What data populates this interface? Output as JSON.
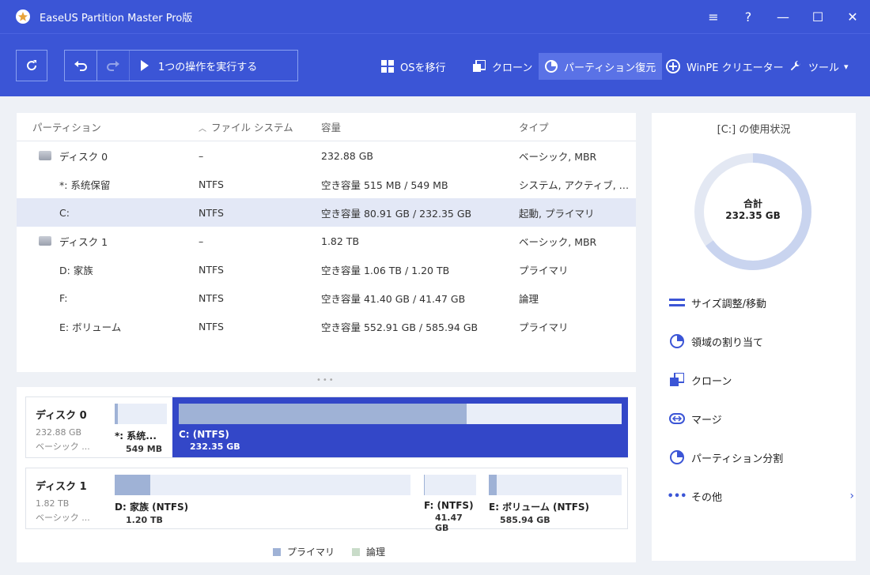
{
  "window": {
    "title": "EaseUS Partition Master Pro版",
    "controls": [
      "≡",
      "?",
      "—",
      "☐",
      "✕"
    ]
  },
  "toolbar": {
    "execute_label": "1つの操作を実行する",
    "nav": [
      {
        "label": "OSを移行",
        "icon": "windows-icon"
      },
      {
        "label": "クローン",
        "icon": "clone-icon"
      },
      {
        "label": "パーティション復元",
        "icon": "pie-icon",
        "active": true
      },
      {
        "label": "WinPE クリエーター",
        "icon": "plus-circle-icon"
      },
      {
        "label": "ツール",
        "icon": "wrench-icon"
      }
    ]
  },
  "table": {
    "headers": [
      "パーティション",
      "ファイル システム",
      "容量",
      "タイプ"
    ],
    "rows": [
      {
        "name": "ディスク 0",
        "fs": "–",
        "cap": "232.88 GB",
        "type": "ベーシック, MBR",
        "disk": true
      },
      {
        "name": "*: 系统保留",
        "fs": "NTFS",
        "cap": "空き容量 515 MB / 549 MB",
        "type": "システム, アクティブ, プライマリ"
      },
      {
        "name": "C:",
        "fs": "NTFS",
        "cap": "空き容量 80.91 GB / 232.35 GB",
        "type": "起動, プライマリ",
        "selected": true
      },
      {
        "name": "ディスク 1",
        "fs": "–",
        "cap": "1.82 TB",
        "type": "ベーシック, MBR",
        "disk": true
      },
      {
        "name": "D: 家族",
        "fs": "NTFS",
        "cap": "空き容量 1.06 TB / 1.20 TB",
        "type": "プライマリ"
      },
      {
        "name": "F:",
        "fs": "NTFS",
        "cap": "空き容量 41.40 GB / 41.47 GB",
        "type": "論理"
      },
      {
        "name": "E: ボリューム",
        "fs": "NTFS",
        "cap": "空き容量 552.91 GB / 585.94 GB",
        "type": "プライマリ"
      }
    ]
  },
  "diskmap": {
    "disk0": {
      "name": "ディスク 0",
      "size": "232.88 GB",
      "type": "ベーシック ...",
      "parts": [
        {
          "name": "*: 系统...",
          "size": "549 MB",
          "used": 0.06
        },
        {
          "name": "C: (NTFS)",
          "size": "232.35 GB",
          "used": 0.65
        }
      ]
    },
    "disk1": {
      "name": "ディスク 1",
      "size": "1.82 TB",
      "type": "ベーシック ...",
      "parts": [
        {
          "name": "D: 家族 (NTFS)",
          "size": "1.20 TB",
          "used": 0.12
        },
        {
          "name": "F: (NTFS)",
          "size": "41.47 GB",
          "used": 0.02
        },
        {
          "name": "E: ボリューム (NTFS)",
          "size": "585.94 GB",
          "used": 0.06
        }
      ]
    },
    "legend": [
      {
        "label": "プライマリ",
        "color": "#9fb2d6"
      },
      {
        "label": "論理",
        "color": "#c9dcc9"
      }
    ]
  },
  "usage": {
    "title": "[C:] の使用状況",
    "total_label": "合計",
    "total_value": "232.35 GB",
    "used_fraction": 0.65
  },
  "actions": [
    {
      "label": "サイズ調整/移動",
      "icon": "resize-icon"
    },
    {
      "label": "領域の割り当て",
      "icon": "pie-icon"
    },
    {
      "label": "クローン",
      "icon": "clone-icon"
    },
    {
      "label": "マージ",
      "icon": "merge-icon"
    },
    {
      "label": "パーティション分割",
      "icon": "pie-icon"
    },
    {
      "label": "その他",
      "icon": "more-icon"
    }
  ],
  "colors": {
    "brand": "#3b55d6",
    "selected": "#3347c8",
    "used": "#9fb2d6"
  }
}
